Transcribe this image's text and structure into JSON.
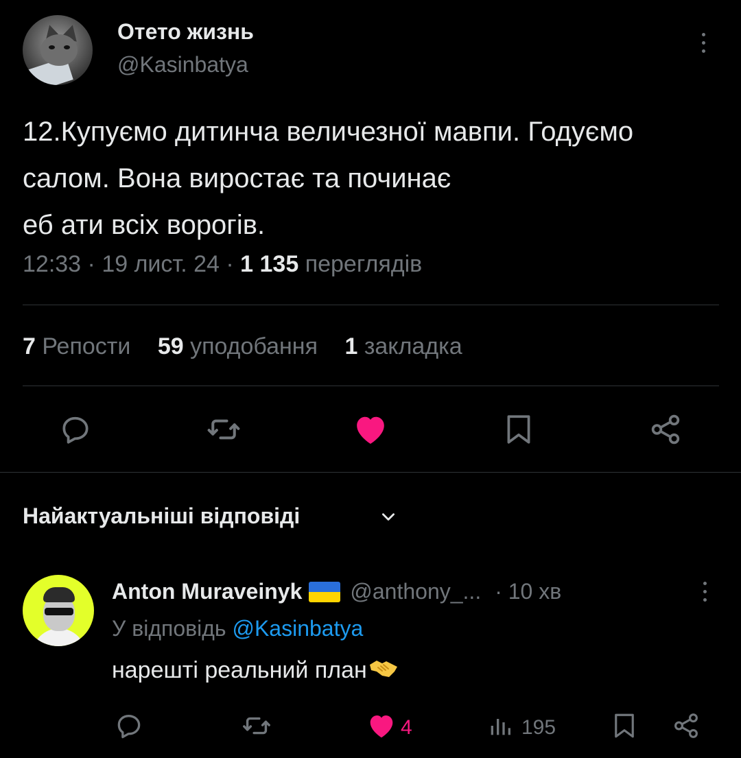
{
  "tweet": {
    "author_name": "Отето жизнь",
    "author_handle": "@Kasinbatya",
    "text": "12.Купуємо дитинча величезної мавпи. Годуємо салом. Вона виростає та починає\nеб ати всіх ворогів.",
    "time": "12:33",
    "date": "19 лист. 24",
    "views_count": "1 135",
    "views_label": "переглядів",
    "separator": " · "
  },
  "stats": {
    "reposts_count": "7",
    "reposts_label": "Репости",
    "likes_count": "59",
    "likes_label": "уподобання",
    "bookmarks_count": "1",
    "bookmarks_label": "закладка"
  },
  "replies_section": {
    "title": "Найактуальніші відповіді"
  },
  "reply": {
    "author_name": "Anton Muraveinyk",
    "author_handle": "@anthony_...",
    "time": "· 10 хв",
    "reply_to_prefix": "У відповідь ",
    "reply_to_handle": "@Kasinbatya",
    "text": "нарешті реальний план",
    "likes": "4",
    "views": "195"
  },
  "colors": {
    "background": "#000000",
    "text": "#e7e9ea",
    "muted": "#71767b",
    "like": "#f91880",
    "link": "#1d9bf0",
    "divider": "#2f3336"
  },
  "icons": [
    "more-vertical-icon",
    "reply-icon",
    "repost-icon",
    "heart-icon",
    "bookmark-icon",
    "share-icon",
    "chevron-down-icon",
    "views-icon",
    "handshake-emoji",
    "ukraine-flag-icon"
  ]
}
